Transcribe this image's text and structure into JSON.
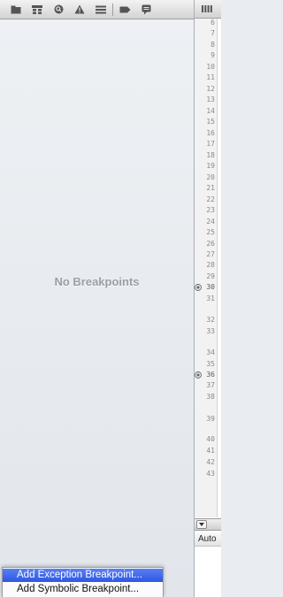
{
  "navigator": {
    "tabs": [
      {
        "name": "project-navigator-icon"
      },
      {
        "name": "symbol-navigator-icon"
      },
      {
        "name": "search-navigator-icon"
      },
      {
        "name": "issue-navigator-icon"
      },
      {
        "name": "debug-navigator-icon"
      },
      {
        "name": "breakpoint-navigator-icon"
      },
      {
        "name": "log-navigator-icon"
      }
    ],
    "empty_message": "No Breakpoints"
  },
  "context_menu": {
    "items": [
      {
        "label": "Add Exception Breakpoint...",
        "selected": true
      },
      {
        "label": "Add Symbolic Breakpoint...",
        "selected": false
      }
    ]
  },
  "editor": {
    "line_numbers": [
      "6",
      "7",
      "8",
      "9",
      "10",
      "11",
      "12",
      "13",
      "14",
      "15",
      "16",
      "17",
      "18",
      "19",
      "20",
      "21",
      "22",
      "23",
      "24",
      "25",
      "26",
      "27",
      "28",
      "29",
      "30",
      "31",
      "32",
      "33",
      "34",
      "35",
      "36",
      "37",
      "38",
      "39",
      "40",
      "41",
      "42",
      "43"
    ],
    "breakpoint_lines": [
      "30",
      "36"
    ],
    "variables_scope": "Auto"
  },
  "colors": {
    "selection": "#3a62ea",
    "empty_text": "#9b9fa5"
  }
}
